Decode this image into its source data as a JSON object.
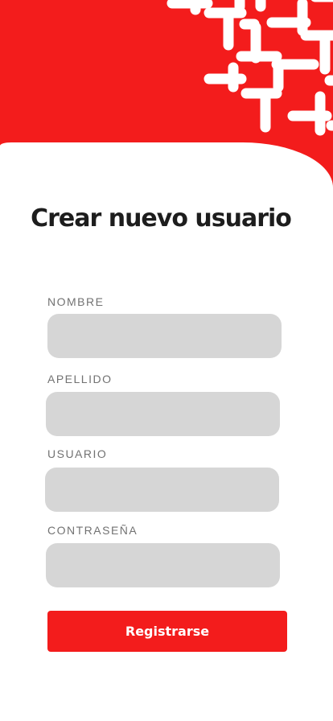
{
  "colors": {
    "brand_red": "#f31c1c",
    "field_bg": "#d6d6d6",
    "title_text": "#1d1d1d",
    "label_text": "#727272",
    "button_text": "#ffffff"
  },
  "header": {
    "pattern_icon": "decorative-cross-pattern"
  },
  "form": {
    "title": "Crear nuevo usuario",
    "fields": [
      {
        "label": "NOMBRE",
        "value": "",
        "placeholder": ""
      },
      {
        "label": "APELLIDO",
        "value": "",
        "placeholder": ""
      },
      {
        "label": "USUARIO",
        "value": "",
        "placeholder": ""
      },
      {
        "label": "CONTRASEÑA",
        "value": "",
        "placeholder": ""
      }
    ],
    "submit_label": "Registrarse"
  }
}
